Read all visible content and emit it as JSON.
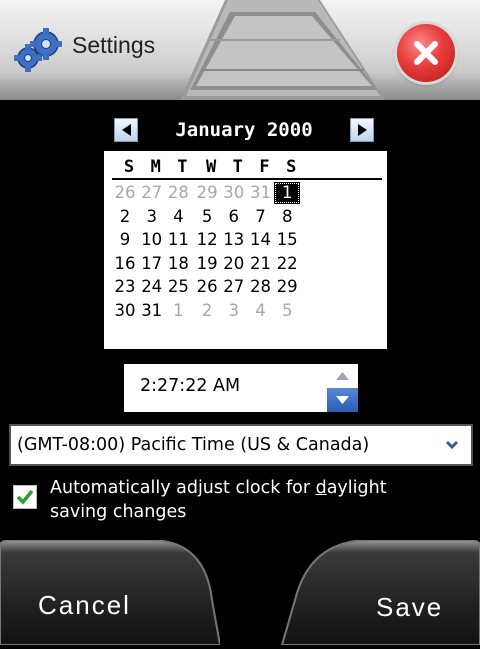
{
  "header": {
    "title": "Settings",
    "app_icon": "gears-icon",
    "close_icon": "close-icon"
  },
  "calendar": {
    "month_label": "January 2000",
    "weekdays": [
      "S",
      "M",
      "T",
      "W",
      "T",
      "F",
      "S"
    ],
    "weeks": [
      [
        "26",
        "27",
        "28",
        "29",
        "30",
        "31",
        "1"
      ],
      [
        "2",
        "3",
        "4",
        "5",
        "6",
        "7",
        "8"
      ],
      [
        "9",
        "10",
        "11",
        "12",
        "13",
        "14",
        "15"
      ],
      [
        "16",
        "17",
        "18",
        "19",
        "20",
        "21",
        "22"
      ],
      [
        "23",
        "24",
        "25",
        "26",
        "27",
        "28",
        "29"
      ],
      [
        "30",
        "31",
        "1",
        "2",
        "3",
        "4",
        "5"
      ]
    ],
    "selected_day": "1"
  },
  "time": {
    "value": "2:27:22 AM"
  },
  "timezone": {
    "value": "(GMT-08:00) Pacific Time (US & Canada)"
  },
  "daylight": {
    "checked": true,
    "label_pre": "Automatically adjust clock for ",
    "label_underlined": "d",
    "label_post": "aylight",
    "label_line2": "saving changes"
  },
  "buttons": {
    "cancel": "Cancel",
    "save": "Save"
  },
  "colors": {
    "selected_day_bg": "#000000",
    "close_button": "#e83b3b",
    "spinner_accent": "#2b5db4",
    "check": "#2e9e2e"
  }
}
